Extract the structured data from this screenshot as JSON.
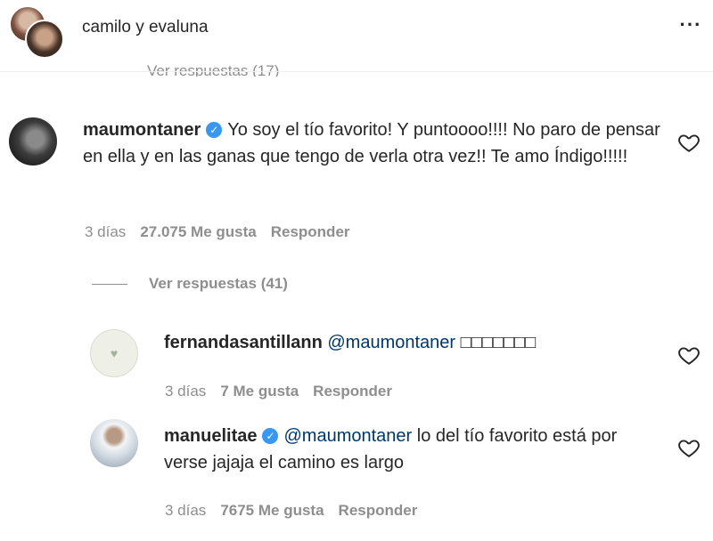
{
  "header": {
    "account_name_1": "camilo",
    "account_sep": "y",
    "account_name_2": "evaluna",
    "more_icon": "more-horizontal-icon",
    "more_glyph": "···"
  },
  "partial_above": {
    "text": "Ver respuestas (17)"
  },
  "comments": [
    {
      "username": "maumontaner",
      "verified": true,
      "text": "Yo soy el tío favorito! Y puntoooo!!!! No paro de pensar en ella y en las ganas que tengo de verla otra vez!! Te amo Índigo!!!!!",
      "time": "3 días",
      "likes": "27.075 Me gusta",
      "reply": "Responder",
      "view_replies": "Ver respuestas (41)"
    }
  ],
  "replies": [
    {
      "username": "fernandasantillann",
      "verified": false,
      "mention": "@maumontaner",
      "text": "□□□□□□□",
      "time": "3 días",
      "likes": "7 Me gusta",
      "reply": "Responder"
    },
    {
      "username": "manuelitae",
      "verified": true,
      "mention": "@maumontaner",
      "text": "lo del tío favorito está por verse jajaja el camino es largo",
      "time": "3 días",
      "likes": "7675 Me gusta",
      "reply": "Responder"
    }
  ],
  "icons": {
    "heart": "heart-outline-icon",
    "verified": "verified-badge-icon",
    "verified_glyph": "✓"
  },
  "colors": {
    "text": "#262626",
    "muted": "#8e8e8e",
    "mention": "#00376b",
    "verified": "#3897f0"
  }
}
